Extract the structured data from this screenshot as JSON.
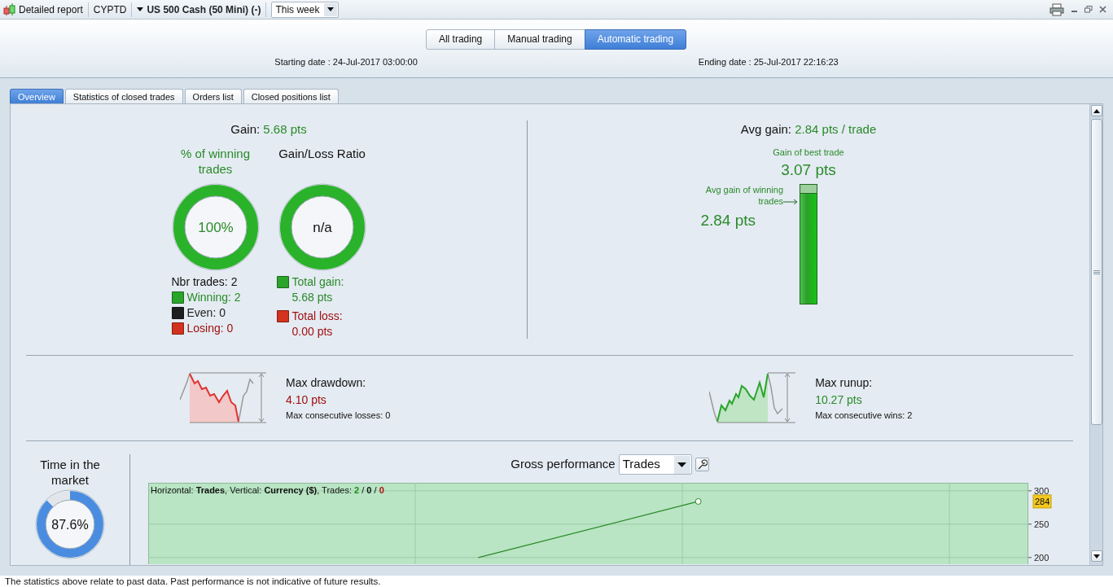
{
  "toolbar": {
    "title": "Detailed report",
    "account": "CYPTD",
    "instrument": "US 500 Cash (50 Mini) (-)",
    "period": {
      "value": "This week"
    }
  },
  "modes": [
    {
      "label": "All trading",
      "selected": false
    },
    {
      "label": "Manual trading",
      "selected": false
    },
    {
      "label": "Automatic trading",
      "selected": true
    }
  ],
  "dates": [
    {
      "label": "Starting date :",
      "value": "24-Jul-2017 03:00:00"
    },
    {
      "label": "Ending date :",
      "value": "25-Jul-2017 22:16:23"
    }
  ],
  "tabs": [
    {
      "label": "Overview",
      "selected": true
    },
    {
      "label": "Statistics of closed trades",
      "selected": false
    },
    {
      "label": "Orders list",
      "selected": false
    },
    {
      "label": "Closed positions list",
      "selected": false
    }
  ],
  "overview": {
    "gain": {
      "label": "Gain:",
      "value": "5.68 pts"
    },
    "winning_pct": {
      "title": "% of winning trades",
      "value": "100%",
      "level": 1
    },
    "ratio": {
      "title": "Gain/Loss Ratio",
      "value": "n/a"
    },
    "nbr_trades": "Nbr trades: 2",
    "trade_counts": [
      {
        "label": "Winning: 2",
        "color": "#2aa52a"
      },
      {
        "label": "Even: 0",
        "color": "#1e1e1e"
      },
      {
        "label": "Losing: 0",
        "color": "#d2321e"
      }
    ],
    "totals": [
      {
        "label": "Total gain:",
        "value": "5.68 pts",
        "color": "#2aa52a"
      },
      {
        "label": "Total loss:",
        "value": "0.00 pts",
        "color": "#d2321e"
      }
    ],
    "avg_gain": {
      "label": "Avg gain:",
      "value": "2.84 pts / trade",
      "best_label": "Gain of best trade",
      "best_value": "3.07 pts",
      "avg_label": "Avg gain of winning trades",
      "avg_value": "2.84 pts",
      "level": 0.925
    },
    "extremes": [
      {
        "kind": "drawdown",
        "label": "Max drawdown:",
        "value": "4.10 pts",
        "note": "Max consecutive losses: 0"
      },
      {
        "kind": "runup",
        "label": "Max runup:",
        "value": "10.27 pts",
        "note": "Max consecutive wins: 2"
      }
    ],
    "time_in_market": {
      "title": "Time in the market",
      "value": "87.6%",
      "level": 0.876
    },
    "gross_performance": {
      "title": "Gross performance",
      "mode": {
        "value": "Trades"
      },
      "legend": "Horizontal: **Trades**, Vertical: **Currency ($)**, Trades:",
      "trade_counts": [
        {
          "value": "2",
          "color": "#1a8a1a"
        },
        {
          "value": "0",
          "color": "#111111"
        },
        {
          "value": "0",
          "color": "#b01010"
        }
      ],
      "separator": "/",
      "chart_data": {
        "type": "line",
        "categories": [
          null,
          null,
          null,
          null
        ],
        "series": [
          {
            "color": "#2a8a2a",
            "values": [
              null,
              200,
              284,
              null
            ]
          }
        ],
        "ylim": [
          190,
          312
        ],
        "yticks": [
          200,
          250,
          300
        ],
        "grid": true,
        "annotations": [
          "284"
        ]
      }
    }
  },
  "status_bar": "The statistics above relate to past data. Past performance is not indicative of future results."
}
